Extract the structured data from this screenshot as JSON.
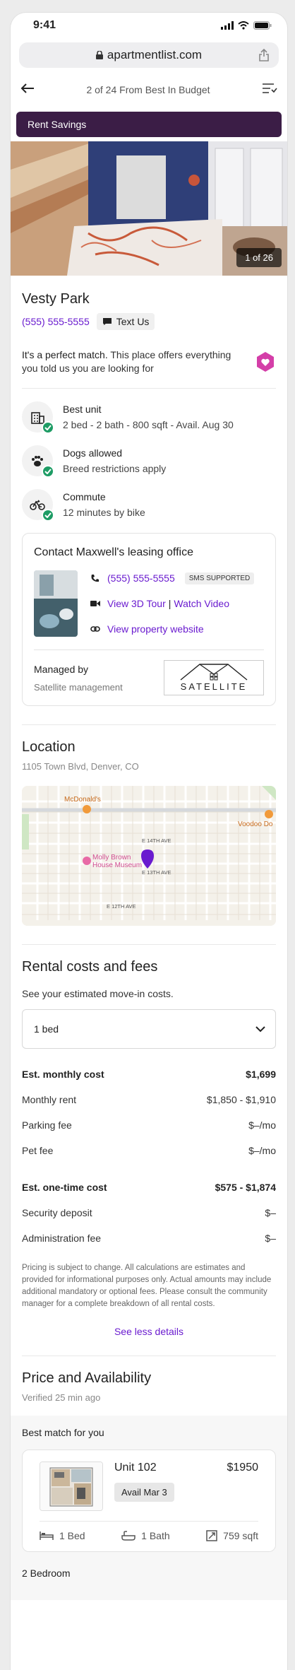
{
  "status_bar": {
    "time": "9:41"
  },
  "browser": {
    "url": "apartmentlist.com"
  },
  "nav": {
    "title": "2 of 24 From Best In Budget"
  },
  "banner": {
    "label": "Rent Savings"
  },
  "photo": {
    "counter": "1 of 26"
  },
  "property": {
    "name": "Vesty Park",
    "phone": "(555) 555-5555",
    "text_us": "Text Us",
    "match_bold": "It's a perfect match.",
    "match_text": " This place offers everything you told us you are looking for"
  },
  "features": [
    {
      "icon": "building-icon",
      "title": "Best unit",
      "sub": "2 bed - 2 bath - 800 sqft - Avail. Aug 30"
    },
    {
      "icon": "paw-icon",
      "title": "Dogs allowed",
      "sub": "Breed restrictions apply"
    },
    {
      "icon": "bike-icon",
      "title": "Commute",
      "sub": "12 minutes by bike"
    }
  ],
  "office": {
    "title": "Contact Maxwell's leasing office",
    "phone": "(555) 555-5555",
    "sms_badge": "SMS SUPPORTED",
    "tour": "View 3D Tour",
    "sep": "|",
    "video": "Watch Video",
    "website": "View property website",
    "managed_by": "Managed by",
    "manager": "Satellite management",
    "logo_text": "SATELLITE"
  },
  "location": {
    "title": "Location",
    "address": "1105 Town Blvd, Denver, CO",
    "map_labels": {
      "mcdonalds": "McDonald's",
      "voodoo": "Voodoo Do",
      "museum_1": "Molly Brown",
      "museum_2": "House Museum",
      "ave14": "E 14TH AVE",
      "ave13": "E 13TH AVE",
      "ave12": "E 12TH AVE"
    }
  },
  "rental": {
    "title": "Rental costs and fees",
    "intro": "See your estimated move-in costs.",
    "select_value": "1 bed",
    "monthly": [
      {
        "label": "Est. monthly cost",
        "value": "$1,699",
        "head": true
      },
      {
        "label": "Monthly rent",
        "value": "$1,850 - $1,910"
      },
      {
        "label": "Parking fee",
        "value": "$–/mo"
      },
      {
        "label": "Pet fee",
        "value": "$–/mo"
      }
    ],
    "onetime": [
      {
        "label": "Est. one-time cost",
        "value": "$575 - $1,874",
        "head": true
      },
      {
        "label": "Security deposit",
        "value": "$–"
      },
      {
        "label": "Administration fee",
        "value": "$–"
      }
    ],
    "note": "Pricing is subject to change. All calculations are estimates and provided for informational purposes only. Actual amounts may include additional mandatory or optional fees. Please consult the community manager for a complete breakdown of all rental costs.",
    "see_less": "See less details"
  },
  "availability": {
    "title": "Price and Availability",
    "verified": "Verified 25 min ago",
    "best_match": "Best match for you",
    "unit": {
      "name": "Unit 102",
      "avail": "Avail Mar 3",
      "price": "$1950",
      "bed": "1 Bed",
      "bath": "1 Bath",
      "sqft": "759 sqft"
    },
    "next_group": "2 Bedroom"
  },
  "colors": {
    "accent": "#6a1bcf",
    "banner": "#3b1d46",
    "check": "#1e9c65",
    "heart": "#d43ea8"
  }
}
